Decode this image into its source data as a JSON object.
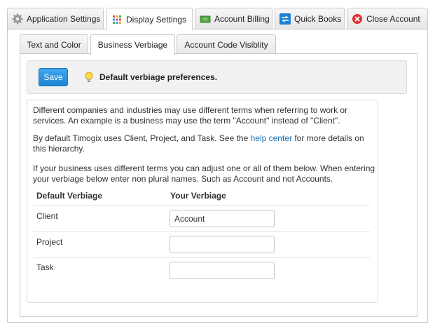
{
  "top_tabs": [
    {
      "label": "Application Settings",
      "icon": "gear-icon"
    },
    {
      "label": "Display Settings",
      "icon": "palette-grid-icon",
      "active": true
    },
    {
      "label": "Account Billing",
      "icon": "money-icon"
    },
    {
      "label": "Quick Books",
      "icon": "sync-arrows-icon"
    },
    {
      "label": "Close Account",
      "icon": "close-circle-icon"
    }
  ],
  "sub_tabs": [
    {
      "label": "Text and Color"
    },
    {
      "label": "Business Verbiage",
      "active": true
    },
    {
      "label": "Account Code Visiblity"
    }
  ],
  "toolbar": {
    "save_label": "Save",
    "message": "Default verbiage preferences."
  },
  "intro": {
    "p1": "Different companies and industries may use different terms when referring to work or services. An example is a business may use the term \"Account\" instead of \"Client\".",
    "p2_before": "By default Timogix uses Client, Project, and Task. See the ",
    "p2_link": "help center",
    "p2_after": " for more details on this hierarchy.",
    "p3": "If your business uses different terms you can adjust one or all of them below. When entering your verbiage below enter non plural names. Such as Account and not Accounts."
  },
  "table": {
    "headers": [
      "Default Verbiage",
      "Your Verbiage"
    ],
    "rows": [
      {
        "default": "Client",
        "value": "Account"
      },
      {
        "default": "Project",
        "value": ""
      },
      {
        "default": "Task",
        "value": ""
      }
    ]
  },
  "colors": {
    "accent": "#1e86d6",
    "link": "#1a6fb5",
    "close_icon": "#e03030",
    "sync_icon": "#1e7fd6"
  }
}
